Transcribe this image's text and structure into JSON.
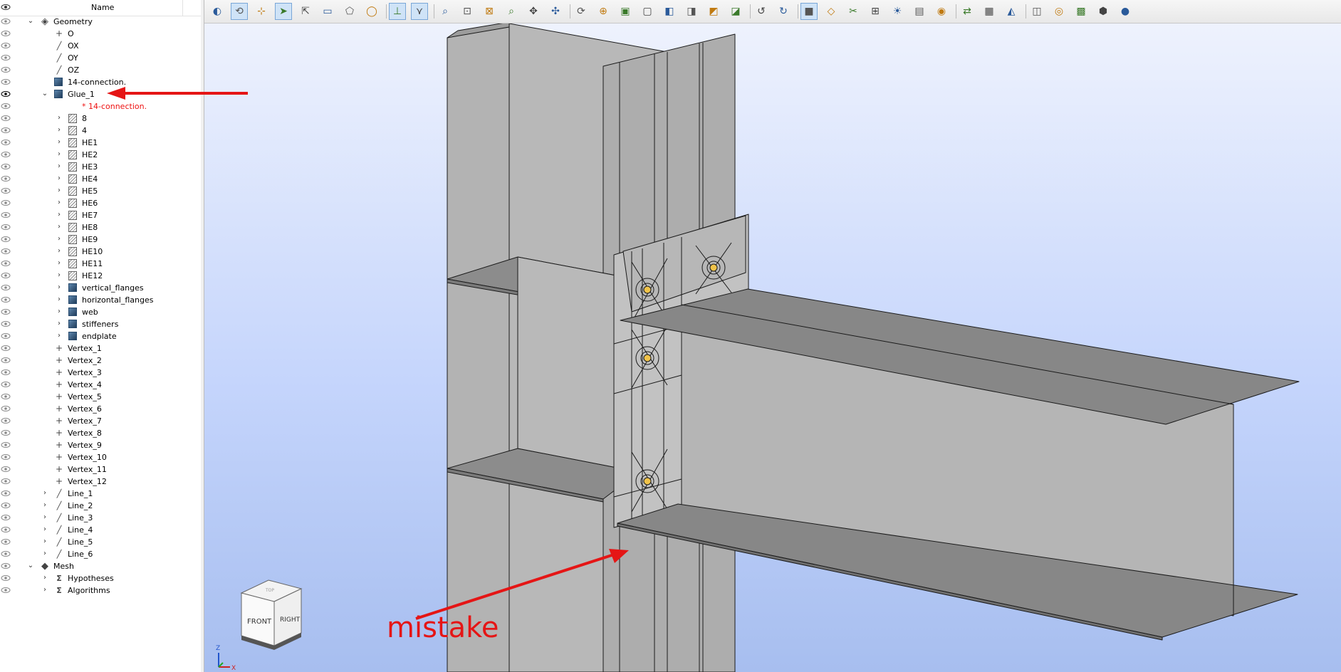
{
  "tree": {
    "column_header": "Name",
    "rows": [
      {
        "label": "Geometry",
        "indent": 0,
        "chevron": "down",
        "icon": "geometry",
        "red": false
      },
      {
        "label": "O",
        "indent": 1,
        "chevron": "",
        "icon": "vertex",
        "red": false
      },
      {
        "label": "OX",
        "indent": 1,
        "chevron": "",
        "icon": "line",
        "red": false
      },
      {
        "label": "OY",
        "indent": 1,
        "chevron": "",
        "icon": "line",
        "red": false
      },
      {
        "label": "OZ",
        "indent": 1,
        "chevron": "",
        "icon": "line",
        "red": false
      },
      {
        "label": "14-connection.",
        "indent": 1,
        "chevron": "",
        "icon": "compound",
        "red": false
      },
      {
        "label": "Glue_1",
        "indent": 1,
        "chevron": "down",
        "icon": "compound",
        "red": false
      },
      {
        "label": "* 14-connection.",
        "indent": 2,
        "chevron": "",
        "icon": "none",
        "red": true
      },
      {
        "label": "8",
        "indent": 2,
        "chevron": "right",
        "icon": "face",
        "red": false
      },
      {
        "label": "4",
        "indent": 2,
        "chevron": "right",
        "icon": "face",
        "red": false
      },
      {
        "label": "HE1",
        "indent": 2,
        "chevron": "right",
        "icon": "face",
        "red": false
      },
      {
        "label": "HE2",
        "indent": 2,
        "chevron": "right",
        "icon": "face",
        "red": false
      },
      {
        "label": "HE3",
        "indent": 2,
        "chevron": "right",
        "icon": "face",
        "red": false
      },
      {
        "label": "HE4",
        "indent": 2,
        "chevron": "right",
        "icon": "face",
        "red": false
      },
      {
        "label": "HE5",
        "indent": 2,
        "chevron": "right",
        "icon": "face",
        "red": false
      },
      {
        "label": "HE6",
        "indent": 2,
        "chevron": "right",
        "icon": "face",
        "red": false
      },
      {
        "label": "HE7",
        "indent": 2,
        "chevron": "right",
        "icon": "face",
        "red": false
      },
      {
        "label": "HE8",
        "indent": 2,
        "chevron": "right",
        "icon": "face",
        "red": false
      },
      {
        "label": "HE9",
        "indent": 2,
        "chevron": "right",
        "icon": "face",
        "red": false
      },
      {
        "label": "HE10",
        "indent": 2,
        "chevron": "right",
        "icon": "face",
        "red": false
      },
      {
        "label": "HE11",
        "indent": 2,
        "chevron": "right",
        "icon": "face",
        "red": false
      },
      {
        "label": "HE12",
        "indent": 2,
        "chevron": "right",
        "icon": "face",
        "red": false
      },
      {
        "label": "vertical_flanges",
        "indent": 2,
        "chevron": "right",
        "icon": "compound",
        "red": false
      },
      {
        "label": "horizontal_flanges",
        "indent": 2,
        "chevron": "right",
        "icon": "compound",
        "red": false
      },
      {
        "label": "web",
        "indent": 2,
        "chevron": "right",
        "icon": "compound",
        "red": false
      },
      {
        "label": "stiffeners",
        "indent": 2,
        "chevron": "right",
        "icon": "compound",
        "red": false
      },
      {
        "label": "endplate",
        "indent": 2,
        "chevron": "right",
        "icon": "compound",
        "red": false
      },
      {
        "label": "Vertex_1",
        "indent": 1,
        "chevron": "",
        "icon": "vertex",
        "red": false
      },
      {
        "label": "Vertex_2",
        "indent": 1,
        "chevron": "",
        "icon": "vertex",
        "red": false
      },
      {
        "label": "Vertex_3",
        "indent": 1,
        "chevron": "",
        "icon": "vertex",
        "red": false
      },
      {
        "label": "Vertex_4",
        "indent": 1,
        "chevron": "",
        "icon": "vertex",
        "red": false
      },
      {
        "label": "Vertex_5",
        "indent": 1,
        "chevron": "",
        "icon": "vertex",
        "red": false
      },
      {
        "label": "Vertex_6",
        "indent": 1,
        "chevron": "",
        "icon": "vertex",
        "red": false
      },
      {
        "label": "Vertex_7",
        "indent": 1,
        "chevron": "",
        "icon": "vertex",
        "red": false
      },
      {
        "label": "Vertex_8",
        "indent": 1,
        "chevron": "",
        "icon": "vertex",
        "red": false
      },
      {
        "label": "Vertex_9",
        "indent": 1,
        "chevron": "",
        "icon": "vertex",
        "red": false
      },
      {
        "label": "Vertex_10",
        "indent": 1,
        "chevron": "",
        "icon": "vertex",
        "red": false
      },
      {
        "label": "Vertex_11",
        "indent": 1,
        "chevron": "",
        "icon": "vertex",
        "red": false
      },
      {
        "label": "Vertex_12",
        "indent": 1,
        "chevron": "",
        "icon": "vertex",
        "red": false
      },
      {
        "label": "Line_1",
        "indent": 1,
        "chevron": "right",
        "icon": "line",
        "red": false
      },
      {
        "label": "Line_2",
        "indent": 1,
        "chevron": "right",
        "icon": "line",
        "red": false
      },
      {
        "label": "Line_3",
        "indent": 1,
        "chevron": "right",
        "icon": "line",
        "red": false
      },
      {
        "label": "Line_4",
        "indent": 1,
        "chevron": "right",
        "icon": "line",
        "red": false
      },
      {
        "label": "Line_5",
        "indent": 1,
        "chevron": "right",
        "icon": "line",
        "red": false
      },
      {
        "label": "Line_6",
        "indent": 1,
        "chevron": "right",
        "icon": "line",
        "red": false
      },
      {
        "label": "Mesh",
        "indent": 0,
        "chevron": "down",
        "icon": "mesh",
        "red": false
      },
      {
        "label": "Hypotheses",
        "indent": 1,
        "chevron": "right",
        "icon": "sigma",
        "red": false
      },
      {
        "label": "Algorithms",
        "indent": 1,
        "chevron": "right",
        "icon": "sigma",
        "red": false
      }
    ]
  },
  "toolbar": {
    "buttons": [
      "dump-view-icon",
      "rotate-point-icon",
      "select-multiple-icon",
      "select-pointer-icon",
      "select-highlight-icon",
      "select-rectangle-icon",
      "select-polygon-icon",
      "select-circle-icon",
      "coordinate-axes-icon",
      "trihedron-icon",
      "zoom-icon",
      "fit-area-icon",
      "fit-all-icon",
      "fit-selection-icon",
      "pan-icon",
      "global-pan-icon",
      "rotate-icon",
      "rotation-point-icon",
      "view-front-icon",
      "view-back-icon",
      "view-top-icon",
      "view-bottom-icon",
      "view-left-icon",
      "view-right-icon",
      "rotate-counterclockwise-icon",
      "rotate-clockwise-icon",
      "view-shaded-icon",
      "view-wireframe-icon",
      "clipping-icon",
      "graduated-axes-icon",
      "ambient-light-icon",
      "background-icon",
      "camera-icon",
      "sync-view-icon",
      "preselection-icon",
      "render-mode-icon",
      "hidden-line-icon",
      "ray-tracing-icon",
      "environment-icon",
      "material-icon",
      "bubble-icon"
    ]
  },
  "viewport": {
    "annotation_text": "mistake",
    "annotation_color": "#e51515",
    "nav_cube": {
      "front": "FRONT",
      "right": "RIGHT",
      "top": "TOP"
    },
    "axes": {
      "x": "X",
      "z": "Z"
    }
  }
}
